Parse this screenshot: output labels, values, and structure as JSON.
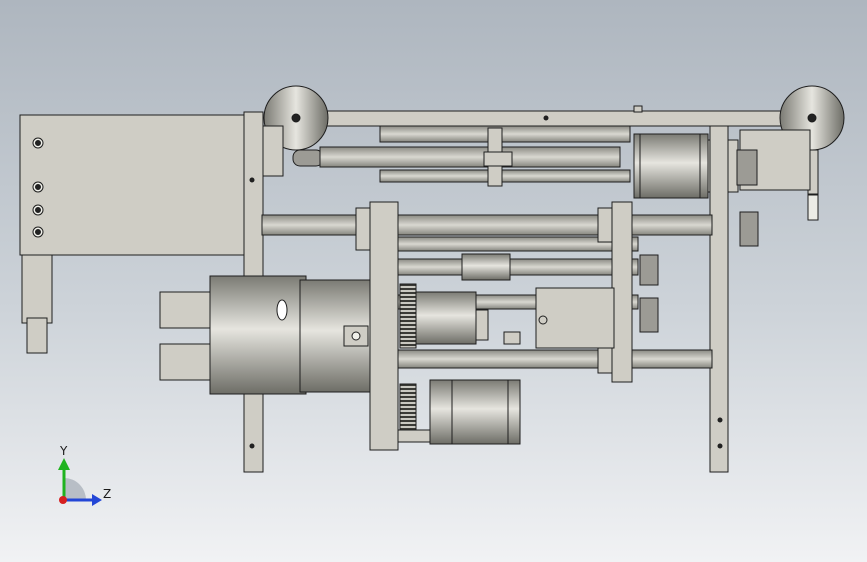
{
  "view": {
    "background_top": "#aeb6bf",
    "background_bottom": "#f1f2f4",
    "part_fill": "#cfcdc5",
    "part_stroke": "#1e1e1e"
  },
  "triad": {
    "y_label": "Y",
    "z_label": "Z",
    "y_color": "#1fb31f",
    "z_color": "#2346d6",
    "x_color": "#d62020"
  }
}
